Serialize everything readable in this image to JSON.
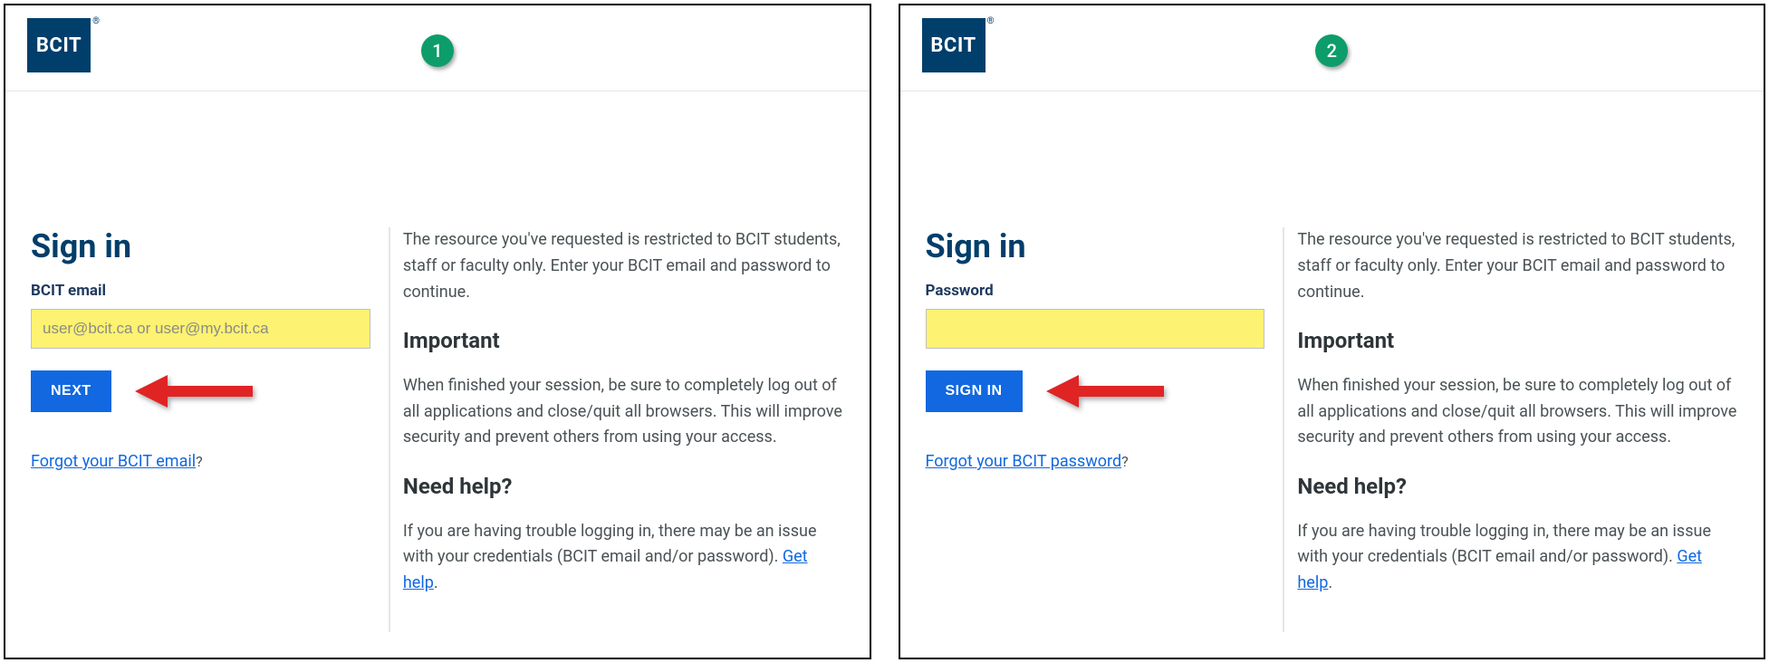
{
  "logo_text": "BCIT",
  "panels": [
    {
      "step": "1",
      "title": "Sign in",
      "field_label": "BCIT email",
      "placeholder": "user@bcit.ca or user@my.bcit.ca",
      "button": "NEXT",
      "forgot_link": "Forgot your BCIT email",
      "forgot_suffix": "?"
    },
    {
      "step": "2",
      "title": "Sign in",
      "field_label": "Password",
      "placeholder": "",
      "button": "SIGN IN",
      "forgot_link": "Forgot your BCIT password",
      "forgot_suffix": "?"
    }
  ],
  "info": {
    "intro": "The resource you've requested is restricted to BCIT students, staff or faculty only. Enter your BCIT email and password to continue.",
    "important_h": "Important",
    "important_p": "When finished your session, be sure to completely log out of all applications and close/quit all browsers. This will improve security and prevent others from using your access.",
    "help_h": "Need help?",
    "help_p_pre": "If you are having trouble logging in, there may be an issue with your credentials (BCIT email and/or password). ",
    "help_link": "Get help",
    "help_p_post": "."
  }
}
